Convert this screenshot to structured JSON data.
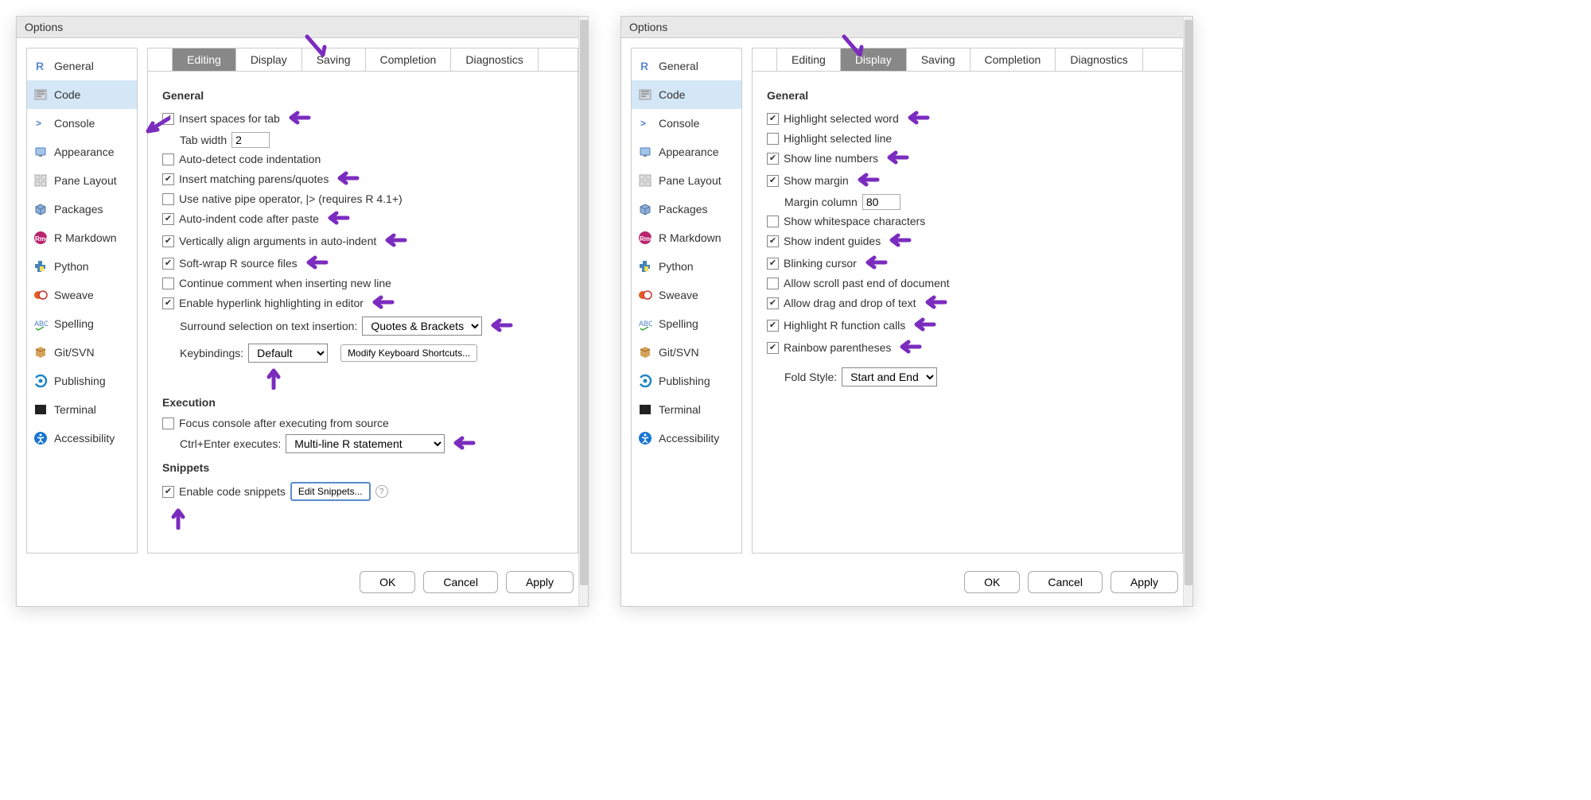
{
  "title": "Options",
  "sidebar": {
    "items": [
      {
        "label": "General",
        "icon": "r"
      },
      {
        "label": "Code",
        "icon": "code",
        "selected": true
      },
      {
        "label": "Console",
        "icon": "console"
      },
      {
        "label": "Appearance",
        "icon": "appearance"
      },
      {
        "label": "Pane Layout",
        "icon": "layout"
      },
      {
        "label": "Packages",
        "icon": "packages"
      },
      {
        "label": "R Markdown",
        "icon": "rmd"
      },
      {
        "label": "Python",
        "icon": "python"
      },
      {
        "label": "Sweave",
        "icon": "sweave"
      },
      {
        "label": "Spelling",
        "icon": "spelling"
      },
      {
        "label": "Git/SVN",
        "icon": "git"
      },
      {
        "label": "Publishing",
        "icon": "publishing"
      },
      {
        "label": "Terminal",
        "icon": "terminal"
      },
      {
        "label": "Accessibility",
        "icon": "accessibility"
      }
    ]
  },
  "tabs": [
    "Editing",
    "Display",
    "Saving",
    "Completion",
    "Diagnostics"
  ],
  "footer": {
    "ok": "OK",
    "cancel": "Cancel",
    "apply": "Apply"
  },
  "panel1": {
    "active_tab": "Editing",
    "sections": {
      "general_title": "General",
      "tab_width_label": "Tab width",
      "tab_width_value": "2",
      "surround_label": "Surround selection on text insertion:",
      "surround_value": "Quotes & Brackets",
      "keybindings_label": "Keybindings:",
      "keybindings_value": "Default",
      "modify_shortcuts": "Modify Keyboard Shortcuts...",
      "execution_title": "Execution",
      "ctrl_enter_label": "Ctrl+Enter executes:",
      "ctrl_enter_value": "Multi-line R statement",
      "snippets_title": "Snippets",
      "edit_snippets": "Edit Snippets..."
    },
    "checkboxes": [
      {
        "label": "Insert spaces for tab",
        "checked": true,
        "arrow": true
      },
      {
        "label": "Auto-detect code indentation",
        "checked": false
      },
      {
        "label": "Insert matching parens/quotes",
        "checked": true,
        "arrow": true
      },
      {
        "label": "Use native pipe operator, |> (requires R 4.1+)",
        "checked": false
      },
      {
        "label": "Auto-indent code after paste",
        "checked": true,
        "arrow": true
      },
      {
        "label": "Vertically align arguments in auto-indent",
        "checked": true,
        "arrow": true
      },
      {
        "label": "Soft-wrap R source files",
        "checked": true,
        "arrow": true
      },
      {
        "label": "Continue comment when inserting new line",
        "checked": false
      },
      {
        "label": "Enable hyperlink highlighting in editor",
        "checked": true,
        "arrow": true
      }
    ],
    "exec_checkbox": {
      "label": "Focus console after executing from source",
      "checked": false
    },
    "snippets_checkbox": {
      "label": "Enable code snippets",
      "checked": true
    }
  },
  "panel2": {
    "active_tab": "Display",
    "sections": {
      "general_title": "General",
      "margin_col_label": "Margin column",
      "margin_col_value": "80",
      "fold_style_label": "Fold Style:",
      "fold_style_value": "Start and End"
    },
    "checkboxes": [
      {
        "label": "Highlight selected word",
        "checked": true,
        "arrow": true
      },
      {
        "label": "Highlight selected line",
        "checked": false
      },
      {
        "label": "Show line numbers",
        "checked": true,
        "arrow": true
      },
      {
        "label": "Show margin",
        "checked": true,
        "arrow": true
      },
      {
        "label": "Show whitespace characters",
        "checked": false,
        "after_margin": true
      },
      {
        "label": "Show indent guides",
        "checked": true,
        "arrow": true
      },
      {
        "label": "Blinking cursor",
        "checked": true,
        "arrow": true
      },
      {
        "label": "Allow scroll past end of document",
        "checked": false
      },
      {
        "label": "Allow drag and drop of text",
        "checked": true,
        "arrow": true
      },
      {
        "label": "Highlight R function calls",
        "checked": true,
        "arrow": true
      },
      {
        "label": "Rainbow parentheses",
        "checked": true,
        "arrow": true
      }
    ]
  }
}
